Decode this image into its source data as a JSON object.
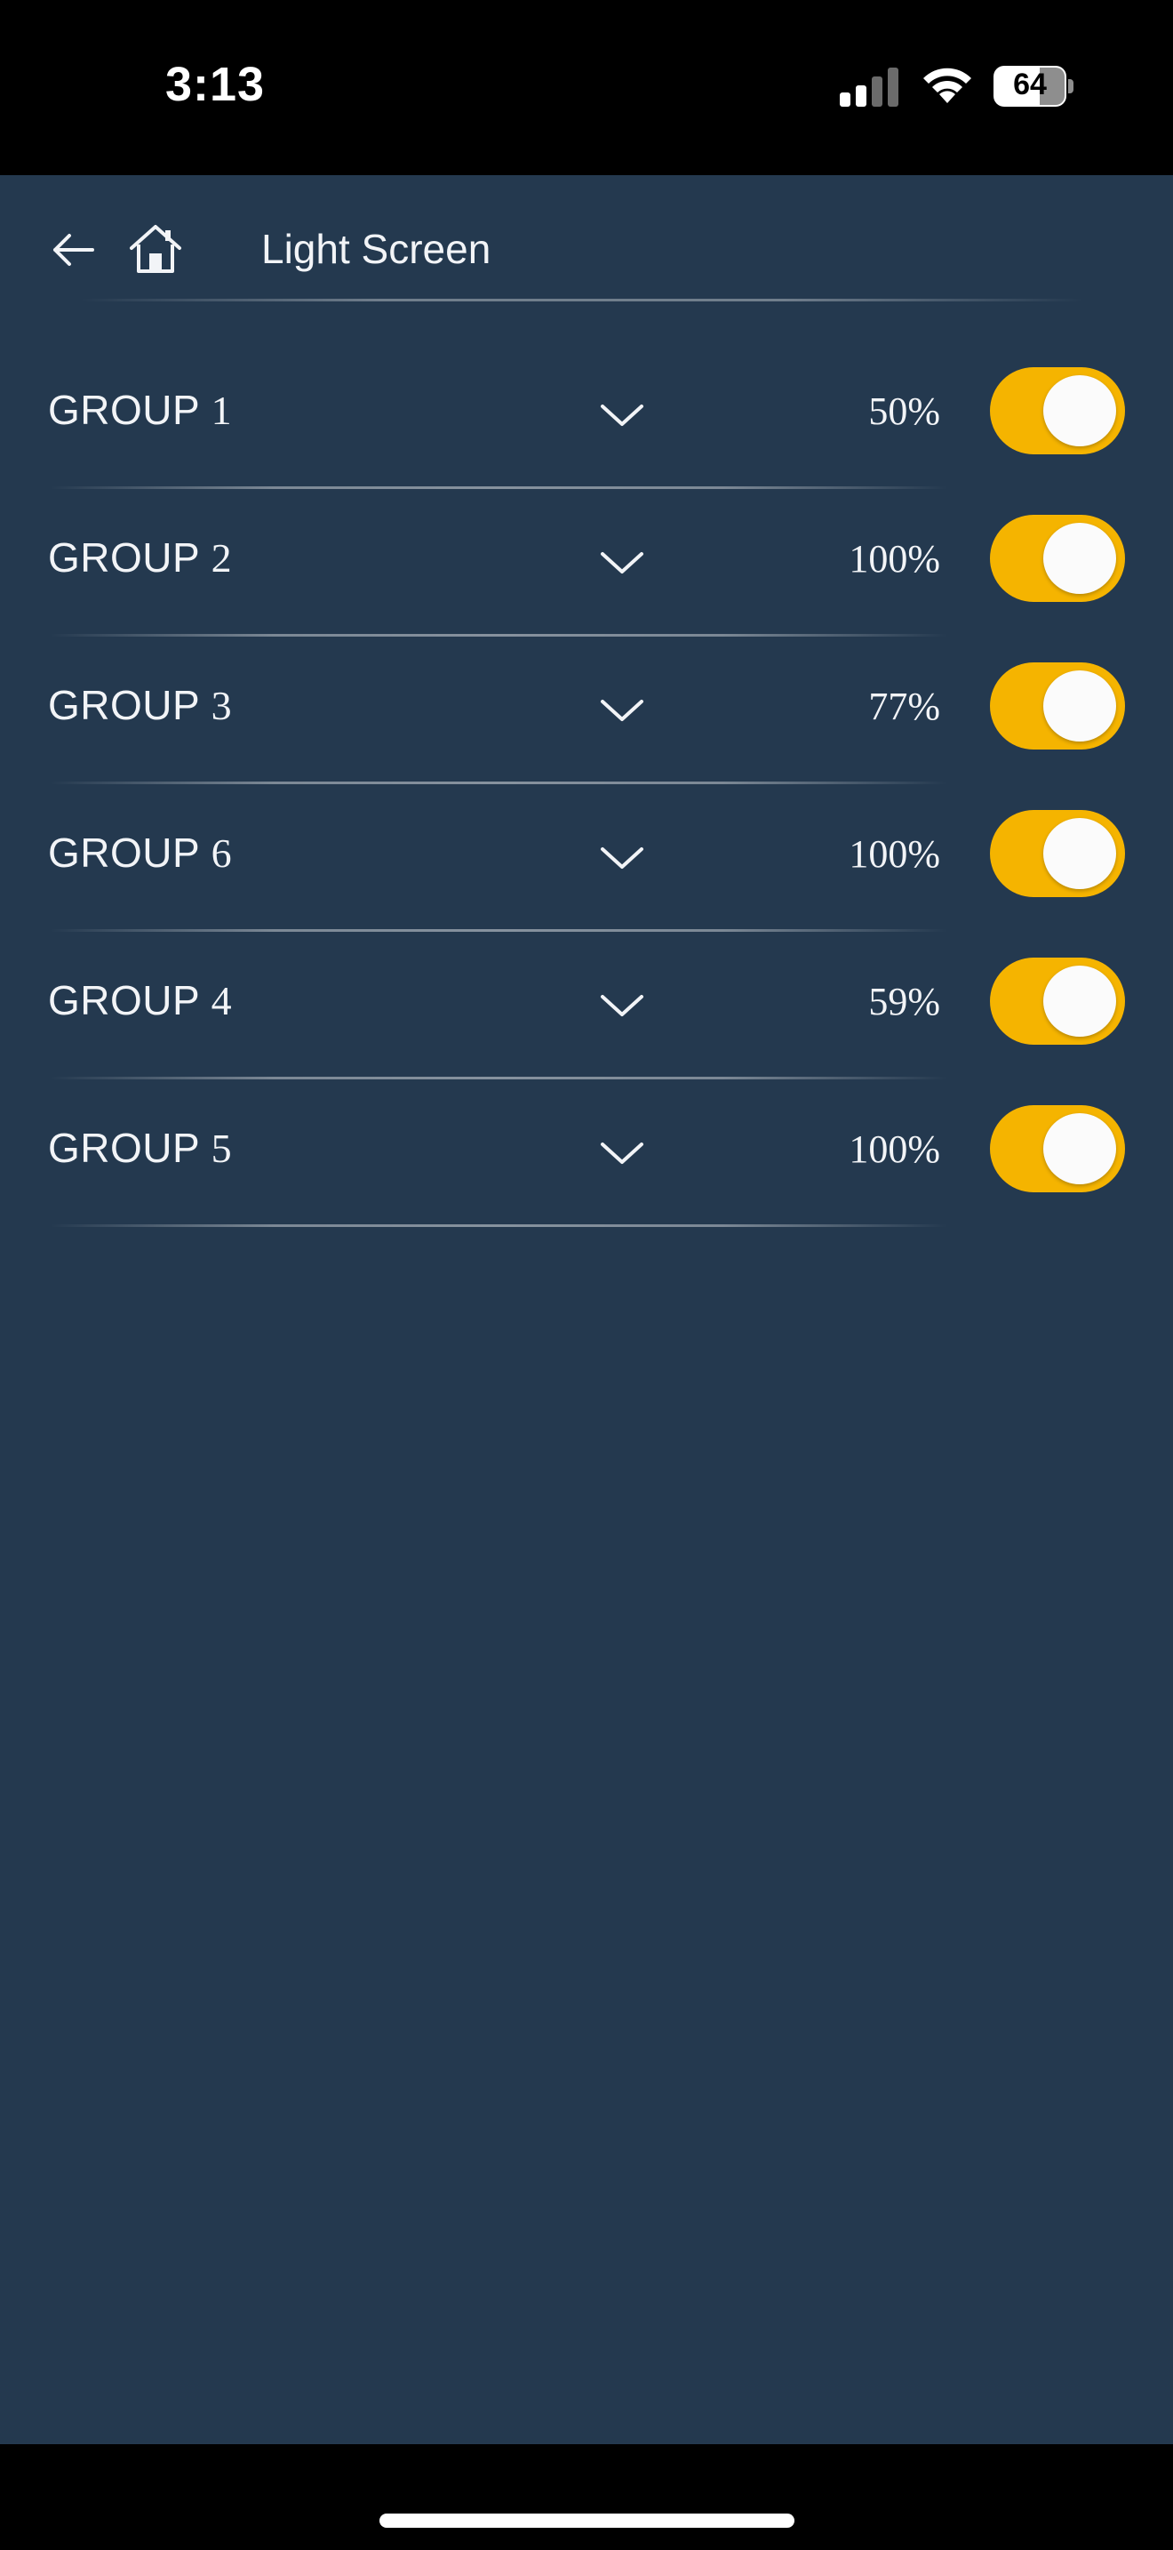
{
  "status_bar": {
    "time": "3:13",
    "battery": "64",
    "icons": [
      "cellular-signal-icon",
      "wifi-icon",
      "battery-icon"
    ]
  },
  "header": {
    "title": "Light Screen",
    "icons": [
      "back-arrow-icon",
      "home-icon"
    ]
  },
  "groups": [
    {
      "label": "GROUP",
      "number": "1",
      "percent": "50%",
      "on": true
    },
    {
      "label": "GROUP",
      "number": "2",
      "percent": "100%",
      "on": true
    },
    {
      "label": "GROUP",
      "number": "3",
      "percent": "77%",
      "on": true
    },
    {
      "label": "GROUP",
      "number": "6",
      "percent": "100%",
      "on": true
    },
    {
      "label": "GROUP",
      "number": "4",
      "percent": "59%",
      "on": true
    },
    {
      "label": "GROUP",
      "number": "5",
      "percent": "100%",
      "on": true
    }
  ],
  "colors": {
    "background": "#24394f",
    "toggle_on": "#f5b400",
    "text": "#f2f4f7"
  }
}
